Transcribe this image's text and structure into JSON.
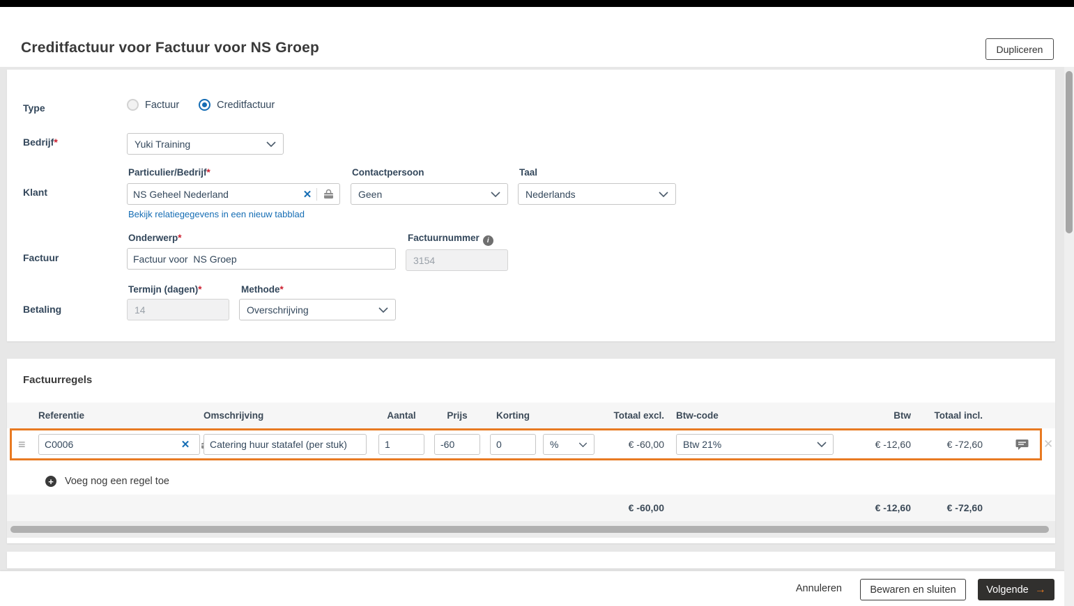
{
  "header": {
    "title": "Creditfactuur voor Factuur voor NS Groep",
    "dupliceren_label": "Dupliceren"
  },
  "form": {
    "type": {
      "label": "Type",
      "options": [
        {
          "label": "Factuur",
          "selected": false
        },
        {
          "label": "Creditfactuur",
          "selected": true
        }
      ]
    },
    "bedrijf": {
      "label": "Bedrijf",
      "required_mark": "*",
      "value": "Yuki Training"
    },
    "klant": {
      "label": "Klant",
      "particulier_bedrijf": {
        "label": "Particulier/Bedrijf",
        "required_mark": "*",
        "value": "NS Geheel Nederland"
      },
      "contactpersoon": {
        "label": "Contactpersoon",
        "value": "Geen"
      },
      "taal": {
        "label": "Taal",
        "value": "Nederlands"
      },
      "relatie_link": "Bekijk relatiegegevens in een nieuw tabblad"
    },
    "factuur": {
      "label": "Factuur",
      "onderwerp": {
        "label": "Onderwerp",
        "required_mark": "*",
        "value": "Factuur voor  NS Groep"
      },
      "factuurnummer": {
        "label": "Factuurnummer",
        "value": "3154"
      }
    },
    "betaling": {
      "label": "Betaling",
      "termijn": {
        "label": "Termijn (dagen)",
        "required_mark": "*",
        "value": "14"
      },
      "methode": {
        "label": "Methode",
        "required_mark": "*",
        "value": "Overschrijving"
      }
    }
  },
  "invoice_lines": {
    "heading": "Factuurregels",
    "columns": [
      "Referentie",
      "Omschrijving",
      "Aantal",
      "Prijs",
      "Korting",
      "Totaal excl.",
      "Btw-code",
      "Btw",
      "Totaal incl."
    ],
    "rows": [
      {
        "referentie": "C0006",
        "omschrijving": "Catering huur statafel (per stuk)",
        "aantal": "1",
        "prijs": "-60",
        "korting": "0",
        "korting_unit": "%",
        "totaal_excl": "€ -60,00",
        "btw_code": "Btw 21%",
        "btw": "€ -12,60",
        "totaal_incl": "€ -72,60"
      }
    ],
    "add_row_label": "Voeg nog een regel toe",
    "totals": {
      "totaal_excl": "€ -60,00",
      "btw": "€ -12,60",
      "totaal_incl": "€ -72,60"
    }
  },
  "footer": {
    "annuleren_label": "Annuleren",
    "bewaren_label": "Bewaren en sluiten",
    "volgende_label": "Volgende",
    "volgende_arrow": "→"
  },
  "icons": {
    "clear": "✕",
    "drag_handle": "≡",
    "add_plus": "+",
    "info": "i",
    "row_remove": "✕"
  },
  "colors": {
    "accent_orange": "#E87A22",
    "link_blue": "#156DB4",
    "dark_button_bg": "#31302E",
    "required_red": "#CC1F2F",
    "selected_row_border": "#E87A22"
  }
}
